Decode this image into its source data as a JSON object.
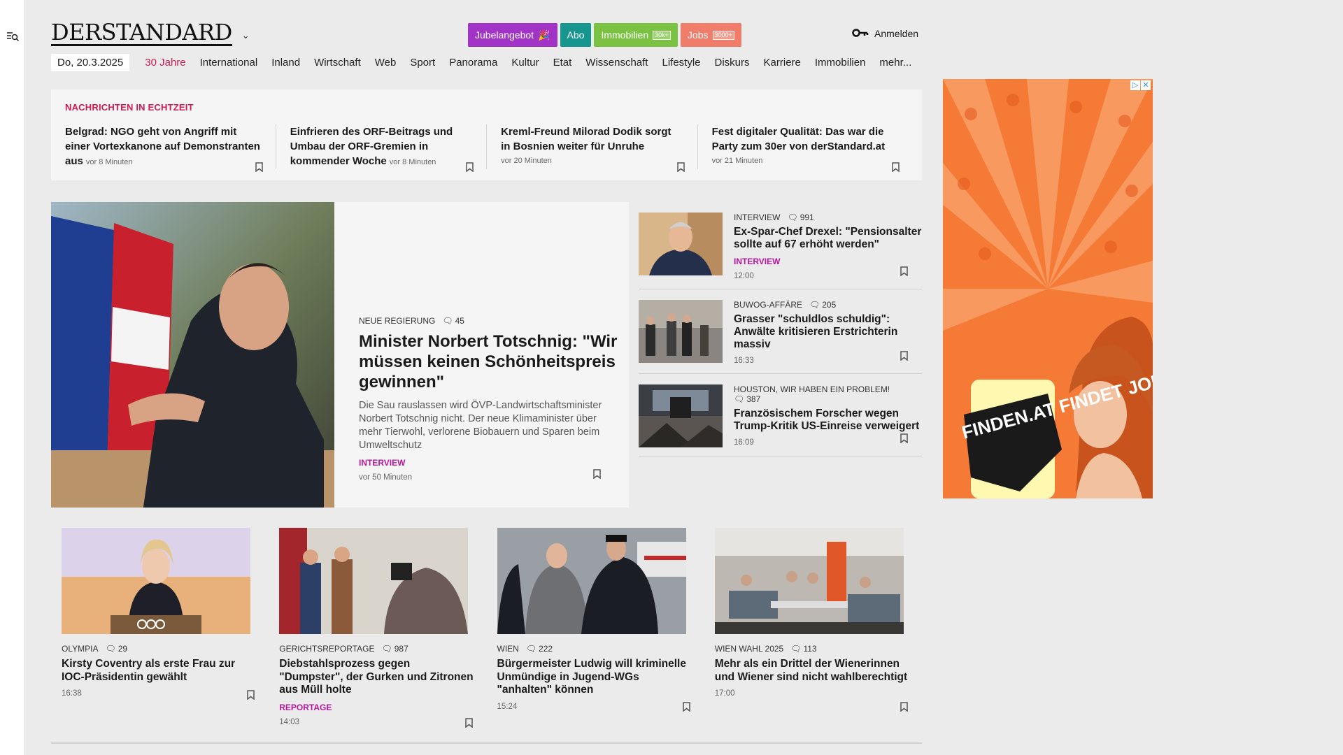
{
  "header": {
    "logo": "DERSTANDARD",
    "promos": [
      {
        "label": "Jubelangebot",
        "color": "#a233c7",
        "badge": ""
      },
      {
        "label": "Abo",
        "color": "#17958f",
        "badge": ""
      },
      {
        "label": "Immobilien",
        "color": "#7cc242",
        "badge": "30k+"
      },
      {
        "label": "Jobs",
        "color": "#f07c6a",
        "badge": "3000+"
      }
    ],
    "login_label": "Anmelden"
  },
  "nav": {
    "date": "Do, 20.3.2025",
    "items": [
      "30 Jahre",
      "International",
      "Inland",
      "Wirtschaft",
      "Web",
      "Sport",
      "Panorama",
      "Kultur",
      "Etat",
      "Wissenschaft",
      "Lifestyle",
      "Diskurs",
      "Karriere",
      "Immobilien",
      "mehr..."
    ]
  },
  "ticker": {
    "heading": "NACHRICHTEN IN ECHTZEIT",
    "items": [
      {
        "title": "Belgrad: NGO geht von Angriff mit einer Vortexkanone auf Demonstranten aus",
        "time": "vor 8 Minuten"
      },
      {
        "title": "Einfrieren des ORF-Beitrags und Umbau der ORF-Gremien in kommender Woche",
        "time": "vor 8 Minuten"
      },
      {
        "title": "Kreml-Freund Milorad Dodik sorgt in Bosnien weiter für Unruhe",
        "time": "vor 20 Minuten"
      },
      {
        "title": "Fest digitaler Qualität: Das war die Party zum 30er von derStandard.at",
        "time": "vor 21 Minuten"
      }
    ]
  },
  "hero": {
    "kicker": "NEUE REGIERUNG",
    "comments": "45",
    "title": "Minister Norbert Totschnig: \"Wir müssen keinen Schönheitspreis gewinnen\"",
    "teaser": "Die Sau rauslassen wird ÖVP-Landwirtschaftsminister Norbert Totschnig nicht. Der neue Klimaminister über mehr Tierwohl, verlorene Biobauern und Sparen beim Umweltschutz",
    "tag": "INTERVIEW",
    "time": "vor 50 Minuten"
  },
  "side": [
    {
      "kicker": "INTERVIEW",
      "comments": "991",
      "title": "Ex-Spar-Chef Drexel: \"Pensionsalter sollte auf 67 erhöht werden\"",
      "tag": "INTERVIEW",
      "time": "12:00"
    },
    {
      "kicker": "BUWOG-AFFÄRE",
      "comments": "205",
      "title": "Grasser \"schuldlos schuldig\": Anwälte kritisieren Erstrichterin massiv",
      "tag": "",
      "time": "16:33"
    },
    {
      "kicker": "HOUSTON, WIR HABEN EIN PROBLEM!",
      "comments": "387",
      "title": "Französischem Forscher wegen Trump-Kritik US-Einreise verweigert",
      "tag": "",
      "time": "16:09"
    }
  ],
  "ad": {
    "text": "FINDEN.AT FINDET JOBS.",
    "color": "#f47a35"
  },
  "cards": [
    {
      "kicker": "OLYMPIA",
      "comments": "29",
      "title": "Kirsty Coventry als erste Frau zur IOC-Präsidentin gewählt",
      "tag": "",
      "time": "16:38"
    },
    {
      "kicker": "GERICHTSREPORTAGE",
      "comments": "987",
      "title": "Diebstahlsprozess gegen \"Dumpster\", der Gurken und Zitronen aus Müll holte",
      "tag": "REPORTAGE",
      "time": "14:03"
    },
    {
      "kicker": "WIEN",
      "comments": "222",
      "title": "Bürgermeister Ludwig will kriminelle Unmündige in Jugend-WGs \"anhalten\" können",
      "tag": "",
      "time": "15:24"
    },
    {
      "kicker": "WIEN WAHL 2025",
      "comments": "113",
      "title": "Mehr als ein Drittel der Wienerinnen und Wiener sind nicht wahlberechtigt",
      "tag": "",
      "time": "17:00"
    }
  ],
  "colors": {
    "accent": "#d11a52",
    "tag": "#b5179e"
  }
}
